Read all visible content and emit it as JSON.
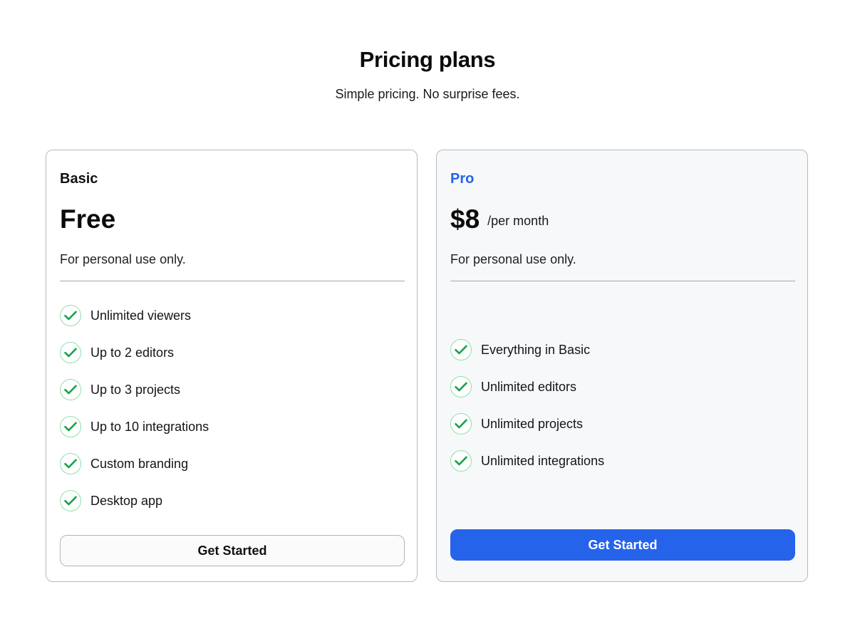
{
  "header": {
    "title": "Pricing plans",
    "subtitle": "Simple pricing. No surprise fees."
  },
  "colors": {
    "accent": "#2563eb",
    "check": "#16a34a",
    "check_ring": "#8ee0a8",
    "pro_card_bg": "#f7f8fa"
  },
  "plans": [
    {
      "name": "Basic",
      "price": "Free",
      "period": "",
      "description": "For personal use only.",
      "features": [
        "Unlimited viewers",
        "Up to 2 editors",
        "Up to 3 projects",
        "Up to 10 integrations",
        "Custom branding",
        "Desktop app"
      ],
      "cta": "Get Started"
    },
    {
      "name": "Pro",
      "price": "$8",
      "period": "/per month",
      "description": "For personal use only.",
      "features": [
        "Everything in Basic",
        "Unlimited editors",
        "Unlimited projects",
        "Unlimited integrations"
      ],
      "cta": "Get Started"
    }
  ]
}
